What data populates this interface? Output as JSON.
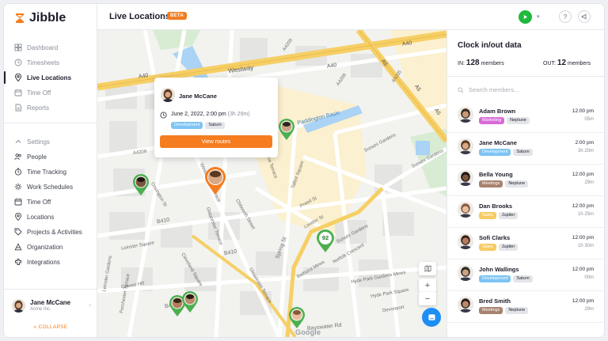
{
  "brand": {
    "name": "Jibble",
    "accent": "#f57c1f"
  },
  "sidebar": {
    "items": [
      {
        "label": "Dashboard",
        "icon": "dashboard-icon"
      },
      {
        "label": "Timesheets",
        "icon": "timesheets-icon"
      },
      {
        "label": "Live Locations",
        "icon": "location-pin-icon",
        "active": true
      },
      {
        "label": "Time Off",
        "icon": "time-off-icon"
      },
      {
        "label": "Reports",
        "icon": "reports-icon"
      }
    ],
    "settings_label": "Settings",
    "settings_items": [
      {
        "label": "People",
        "icon": "people-icon"
      },
      {
        "label": "Time Tracking",
        "icon": "time-tracking-icon"
      },
      {
        "label": "Work Schedules",
        "icon": "work-schedules-icon"
      },
      {
        "label": "Time Off",
        "icon": "time-off-icon"
      },
      {
        "label": "Locations",
        "icon": "location-pin-icon"
      },
      {
        "label": "Projects & Activities",
        "icon": "tag-icon"
      },
      {
        "label": "Organization",
        "icon": "organization-icon"
      },
      {
        "label": "Integrations",
        "icon": "integrations-icon"
      }
    ],
    "user": {
      "name": "Jane McCane",
      "org": "Acme Inc."
    },
    "collapse_label": "COLLAPSE"
  },
  "header": {
    "title": "Live Locations",
    "badge": "BETA"
  },
  "map": {
    "labels": [
      "Westway",
      "A40",
      "A40",
      "A40",
      "A5",
      "A5",
      "A5",
      "A4209",
      "A4209",
      "A4209",
      "A4205",
      "Paddington Basin",
      "Sussex Gardens",
      "Sussex Gardens",
      "Sussex Gardens",
      "Westbourne Terrace",
      "Gloucester Terrace",
      "Gloucester Terrace",
      "Cleveland Square",
      "Chilworth Street",
      "Spring St",
      "B410",
      "B410",
      "B410",
      "Craven Hill",
      "Leinster Gardens",
      "Porchester Terrace",
      "Hyde Park Square",
      "Bayswater Rd",
      "Devonport",
      "Norfolk Crescent",
      "Talbot Square",
      "Praed St",
      "Eastbourne Terrace",
      "Ossington St",
      "London St",
      "Bathurst Mews",
      "Leinster Square",
      "Hyde Park Gardens Mews"
    ],
    "cluster_count": "92",
    "popup": {
      "name": "Jane McCane",
      "datetime": "June 2, 2022, 2:00 pm",
      "duration": "(3h 29m)",
      "tags": [
        {
          "label": "Development",
          "color": "#7cc4f4"
        },
        {
          "label": "Saturn",
          "color": "#e3e5e9"
        }
      ],
      "button": "View routes"
    },
    "attribution": "Google"
  },
  "panel": {
    "title": "Clock in/out data",
    "in_label": "IN:",
    "in_count": "128",
    "out_label": "OUT:",
    "out_count": "12",
    "members_word": "members",
    "search_placeholder": "Search members...",
    "members": [
      {
        "name": "Adam Brown",
        "tag": "Marketing",
        "tag_color": "#d96ad9",
        "project": "Neptune",
        "time": "12:00 pm",
        "dur": "05m",
        "skin": "#c89a76",
        "hair": "#3a2a1e"
      },
      {
        "name": "Jane McCane",
        "tag": "Development",
        "tag_color": "#7cc4f4",
        "project": "Saturn",
        "time": "2:00 pm",
        "dur": "3h 20m",
        "skin": "#d8a783",
        "hair": "#5a3a22"
      },
      {
        "name": "Bella Young",
        "tag": "Meetings",
        "tag_color": "#a8826e",
        "project": "Neptune",
        "time": "12:00 pm",
        "dur": "29m",
        "skin": "#7a5641",
        "hair": "#201510"
      },
      {
        "name": "Dan Brooks",
        "tag": "Sales",
        "tag_color": "#f7cb62",
        "project": "Jupiter",
        "time": "12:00 pm",
        "dur": "1h 25m",
        "skin": "#e8bfa0",
        "hair": "#8a5a3a"
      },
      {
        "name": "Sofi Clarks",
        "tag": "Sales",
        "tag_color": "#f7cb62",
        "project": "Jupiter",
        "time": "12:00 pm",
        "dur": "1h 30m",
        "skin": "#b47d5c",
        "hair": "#3a2418"
      },
      {
        "name": "John Wallings",
        "tag": "Development",
        "tag_color": "#7cc4f4",
        "project": "Saturn",
        "time": "12:00 pm",
        "dur": "00m",
        "skin": "#caa486",
        "hair": "#2e2620"
      },
      {
        "name": "Bred Smith",
        "tag": "Meetings",
        "tag_color": "#a8826e",
        "project": "Neptune",
        "time": "12:00 pm",
        "dur": "29m",
        "skin": "#bb8a6a",
        "hair": "#2a1c14"
      }
    ]
  }
}
